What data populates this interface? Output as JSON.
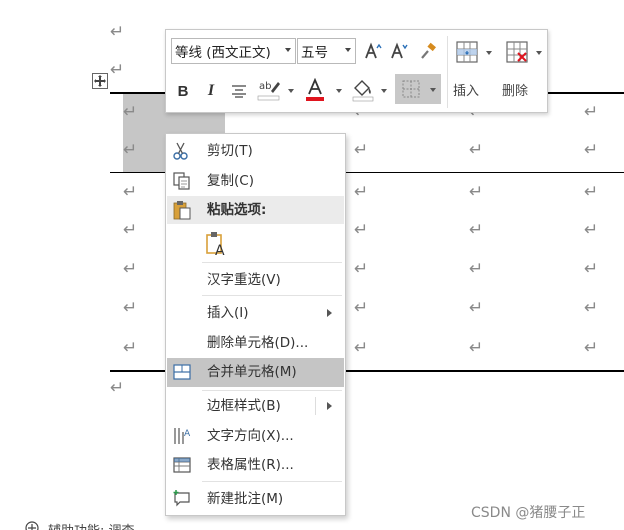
{
  "mini_toolbar": {
    "font_name": "等线 (西文正文)",
    "font_size": "五号",
    "insert_label": "插入",
    "delete_label": "删除"
  },
  "context_menu": {
    "cut": "剪切(T)",
    "copy": "复制(C)",
    "paste_options": "粘贴选项:",
    "reconvert": "汉字重选(V)",
    "insert": "插入(I)",
    "delete_cells": "删除单元格(D)...",
    "merge_cells": "合并单元格(M)",
    "border_styles": "边框样式(B)",
    "text_direction": "文字方向(X)...",
    "table_properties": "表格属性(R)...",
    "new_comment": "新建批注(M)"
  },
  "status_bar": {
    "accessibility": "辅助功能: 调查"
  },
  "watermark": "CSDN @猪腰子正",
  "colors": {
    "font_color": "#e0141e",
    "highlight_menu": "#c5c5c5",
    "selected_cell": "#c6c6c6"
  }
}
